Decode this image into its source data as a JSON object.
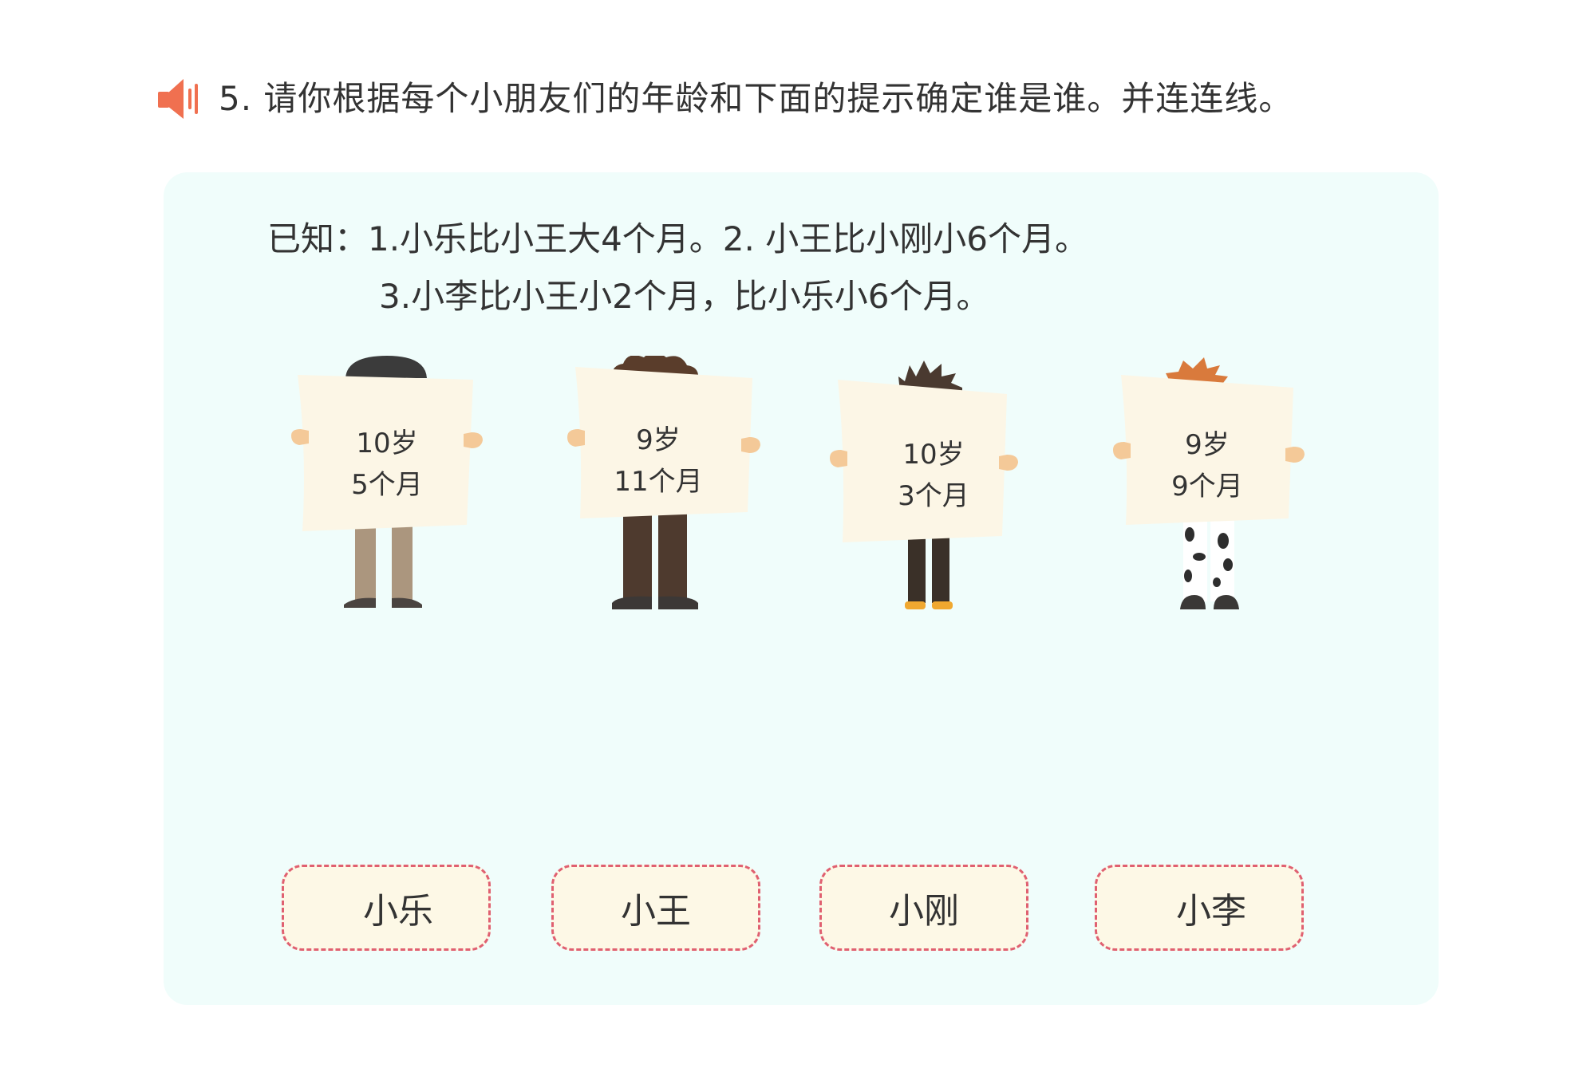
{
  "header": {
    "speaker_icon": "speaker-icon",
    "title": "5. 请你根据每个小朋友们的年龄和下面的提示确定谁是谁。并连连线。"
  },
  "clues": {
    "line1": "已知：1.小乐比小王大4个月。2. 小王比小刚小6个月。",
    "line2": "3.小李比小王小2个月，比小乐小6个月。"
  },
  "kids": [
    {
      "age_years": "10岁",
      "age_months": "5个月"
    },
    {
      "age_years": "9岁",
      "age_months": "11个月"
    },
    {
      "age_years": "10岁",
      "age_months": "3个月"
    },
    {
      "age_years": "9岁",
      "age_months": "9个月"
    }
  ],
  "names": [
    "小乐",
    "小王",
    "小刚",
    "小李"
  ],
  "colors": {
    "accent": "#f07050",
    "panel_bg": "#f0fdfb",
    "sign": "#fcf6e6",
    "name_box_bg": "#fdf8e6",
    "name_box_border": "#e06070"
  }
}
